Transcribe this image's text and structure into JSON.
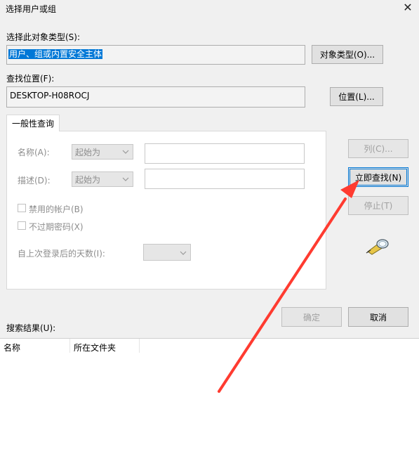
{
  "window": {
    "title": "选择用户或组"
  },
  "object_type": {
    "label": "选择此对象类型(S):",
    "value": "用户、组或内置安全主体",
    "button": "对象类型(O)..."
  },
  "location": {
    "label": "查找位置(F):",
    "value": "DESKTOP-H08ROCJ",
    "button": "位置(L)..."
  },
  "tab": {
    "label": "一般性查询"
  },
  "query": {
    "name_label": "名称(A):",
    "name_mode": "起始为",
    "desc_label": "描述(D):",
    "desc_mode": "起始为",
    "disabled_accounts": "禁用的帐户(B)",
    "no_expire_password": "不过期密码(X)",
    "days_label": "自上次登录后的天数(I):"
  },
  "side_buttons": {
    "columns": "列(C)...",
    "find_now": "立即查找(N)",
    "stop": "停止(T)"
  },
  "dialog_buttons": {
    "ok": "确定",
    "cancel": "取消"
  },
  "results": {
    "label": "搜索结果(U):",
    "columns": [
      "名称",
      "所在文件夹"
    ]
  },
  "colors": {
    "selection": "#0078d7",
    "arrow": "#ff3b30"
  }
}
